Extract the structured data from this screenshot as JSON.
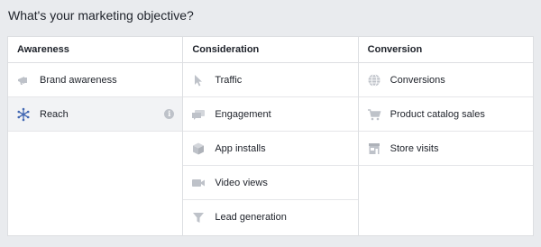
{
  "page": {
    "title": "What's your marketing objective?"
  },
  "columns": [
    {
      "header": "Awareness",
      "items": [
        {
          "label": "Brand awareness",
          "icon": "megaphone-icon"
        },
        {
          "label": "Reach",
          "icon": "reach-icon",
          "selected": true,
          "info_icon": "info-icon"
        }
      ]
    },
    {
      "header": "Consideration",
      "items": [
        {
          "label": "Traffic",
          "icon": "cursor-icon"
        },
        {
          "label": "Engagement",
          "icon": "speech-bubbles-icon"
        },
        {
          "label": "App installs",
          "icon": "cube-icon"
        },
        {
          "label": "Video views",
          "icon": "video-camera-icon"
        },
        {
          "label": "Lead generation",
          "icon": "funnel-icon"
        }
      ]
    },
    {
      "header": "Conversion",
      "items": [
        {
          "label": "Conversions",
          "icon": "globe-icon"
        },
        {
          "label": "Product catalog sales",
          "icon": "shopping-cart-icon"
        },
        {
          "label": "Store visits",
          "icon": "storefront-icon"
        }
      ]
    }
  ],
  "colors": {
    "background": "#e9ebee",
    "icon": "#bec2c9",
    "reach_icon": "#4267b2",
    "selected_row": "#f2f3f5",
    "border": "#dddfe2"
  },
  "info_glyph": "i"
}
